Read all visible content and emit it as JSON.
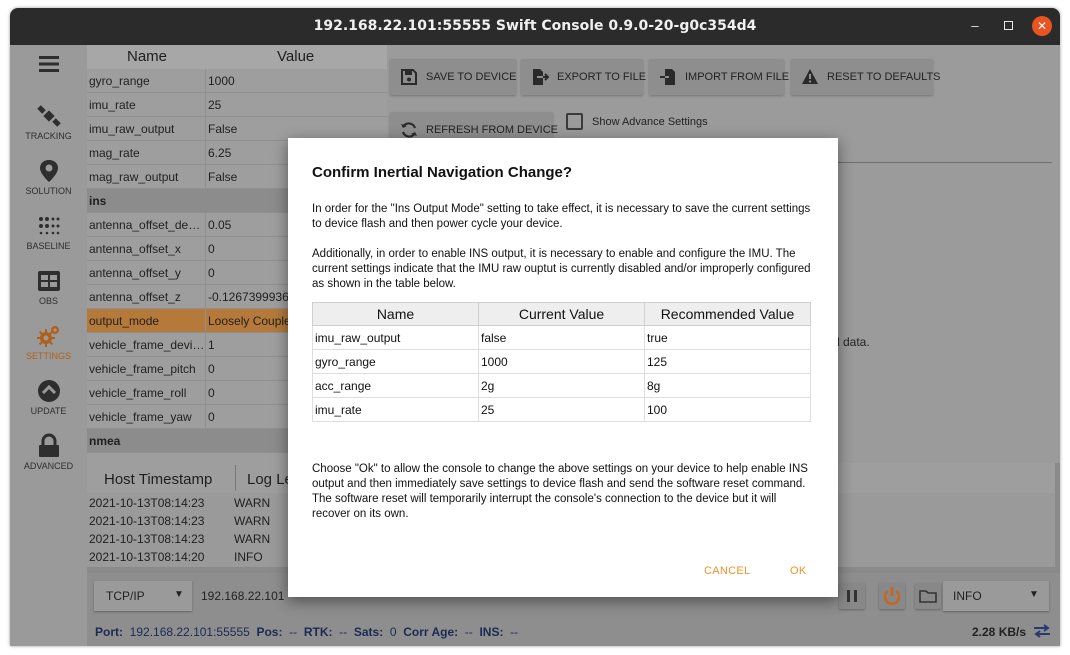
{
  "window": {
    "title": "192.168.22.101:55555 Swift Console 0.9.0-20-g0c354d4"
  },
  "sidebar": {
    "items": [
      {
        "label": "",
        "icon": "menu-icon"
      },
      {
        "label": "TRACKING",
        "icon": "satellite-icon"
      },
      {
        "label": "SOLUTION",
        "icon": "map-pin-icon"
      },
      {
        "label": "BASELINE",
        "icon": "dots-grid-icon"
      },
      {
        "label": "OBS",
        "icon": "table-grid-icon"
      },
      {
        "label": "SETTINGS",
        "icon": "gears-icon"
      },
      {
        "label": "UPDATE",
        "icon": "chevron-up-circle-icon"
      },
      {
        "label": "ADVANCED",
        "icon": "lock-icon"
      }
    ],
    "active_color": "#b0601a"
  },
  "settings_table": {
    "headers": [
      "Name",
      "Value"
    ],
    "rows": [
      {
        "name": "gyro_range",
        "value": "1000"
      },
      {
        "name": "imu_rate",
        "value": "25"
      },
      {
        "name": "imu_raw_output",
        "value": "False"
      },
      {
        "name": "mag_rate",
        "value": "6.25"
      },
      {
        "name": "mag_raw_output",
        "value": "False"
      },
      {
        "name": "ins",
        "value": ""
      },
      {
        "name": "antenna_offset_devi...",
        "value": "0.05"
      },
      {
        "name": "antenna_offset_x",
        "value": "0"
      },
      {
        "name": "antenna_offset_y",
        "value": "0"
      },
      {
        "name": "antenna_offset_z",
        "value": "-0.1267399936"
      },
      {
        "name": "output_mode",
        "value": "Loosely Couple"
      },
      {
        "name": "vehicle_frame_devia...",
        "value": "1"
      },
      {
        "name": "vehicle_frame_pitch",
        "value": "0"
      },
      {
        "name": "vehicle_frame_roll",
        "value": "0"
      },
      {
        "name": "vehicle_frame_yaw",
        "value": "0"
      },
      {
        "name": "nmea",
        "value": ""
      }
    ]
  },
  "toolbar": {
    "save": "SAVE TO DEVICE",
    "export": "EXPORT TO FILE",
    "import": "IMPORT FROM FILE",
    "reset": "RESET TO DEFAULTS",
    "refresh": "REFRESH FROM DEVICE",
    "advanced": "Show Advance Settings"
  },
  "panel": {
    "partial_text": "l data."
  },
  "log": {
    "headers": [
      "Host Timestamp",
      "Log Le"
    ],
    "rows": [
      {
        "time": "2021-10-13T08:14:23",
        "level": "WARN"
      },
      {
        "time": "2021-10-13T08:14:23",
        "level": "WARN"
      },
      {
        "time": "2021-10-13T08:14:23",
        "level": "WARN"
      },
      {
        "time": "2021-10-13T08:14:20",
        "level": "INFO"
      }
    ]
  },
  "connection": {
    "type": "TCP/IP",
    "host": "192.168.22.101",
    "log_level": "INFO"
  },
  "status": {
    "port_label": "Port:",
    "port": "192.168.22.101:55555",
    "pos_label": "Pos:",
    "pos": "--",
    "rtk_label": "RTK:",
    "rtk": "--",
    "sats_label": "Sats:",
    "sats": "0",
    "corr_label": "Corr Age:",
    "corr": "--",
    "ins_label": "INS:",
    "ins": "--",
    "rate": "2.28 KB/s"
  },
  "dialog": {
    "title": "Confirm Inertial Navigation Change?",
    "p1": "In order for the \"Ins Output Mode\" setting to take effect, it is necessary to save the current settings to device flash and then power cycle your device.",
    "p2": "Additionally, in order to enable INS output, it is necessary to enable and configure the IMU. The current settings indicate that the IMU raw ouptut is currently disabled and/or improperly configured as shown in the table below.",
    "table": {
      "headers": [
        "Name",
        "Current Value",
        "Recommended Value"
      ],
      "rows": [
        {
          "name": "imu_raw_output",
          "current": "false",
          "recommended": "true"
        },
        {
          "name": "gyro_range",
          "current": "1000",
          "recommended": "125"
        },
        {
          "name": "acc_range",
          "current": "2g",
          "recommended": "8g"
        },
        {
          "name": "imu_rate",
          "current": "25",
          "recommended": "100"
        }
      ]
    },
    "p3": "Choose \"Ok\" to allow the console to change the above settings on your device to help enable INS output and then immediately save settings to device flash and send the software reset command. The software reset will temporarily interrupt the console's connection to the device but it  will recover on its own.",
    "cancel": "CANCEL",
    "ok": "OK",
    "accent": "#f0932b"
  }
}
